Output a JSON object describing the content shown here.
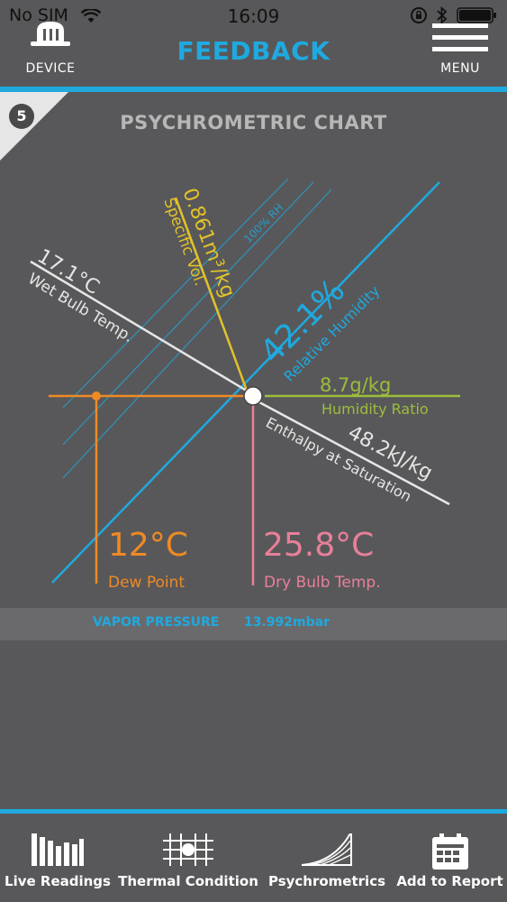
{
  "status": {
    "carrier": "No SIM",
    "time": "16:09"
  },
  "header": {
    "title": "FEEDBACK",
    "left_label": "DEVICE",
    "right_label": "MENU"
  },
  "panel": {
    "number": "5",
    "title": "PSYCHROMETRIC CHART"
  },
  "chart": {
    "rh_curve_label": "100% RH",
    "specific_volume": {
      "value": "0.861m³/kg",
      "label": "Specific Vol."
    },
    "wet_bulb": {
      "value": "17.1°C",
      "label": "Wet Bulb Temp."
    },
    "relative_humidity": {
      "value": "42.1%",
      "label": "Relative Humidity"
    },
    "humidity_ratio": {
      "value": "8.7g/kg",
      "label": "Humidity Ratio"
    },
    "enthalpy": {
      "value": "48.2kJ/kg",
      "label": "Enthalpy at Saturation"
    },
    "dew_point": {
      "value": "12°C",
      "label": "Dew Point"
    },
    "dry_bulb": {
      "value": "25.8°C",
      "label": "Dry Bulb Temp."
    },
    "colors": {
      "blue": "#1fa9de",
      "yellow": "#e3c22a",
      "green": "#9cbd3c",
      "orange": "#ef8a25",
      "pink": "#e97f99",
      "white": "#e6e6e6"
    }
  },
  "vapor": {
    "label": "VAPOR PRESSURE",
    "value": "13.992mbar"
  },
  "tabs": [
    {
      "label": "Live Readings",
      "icon": "bar-chart-icon"
    },
    {
      "label": "Thermal Condition",
      "icon": "grid-dot-icon"
    },
    {
      "label": "Psychrometrics",
      "icon": "psychro-curve-icon"
    },
    {
      "label": "Add to Report",
      "icon": "report-icon"
    }
  ]
}
